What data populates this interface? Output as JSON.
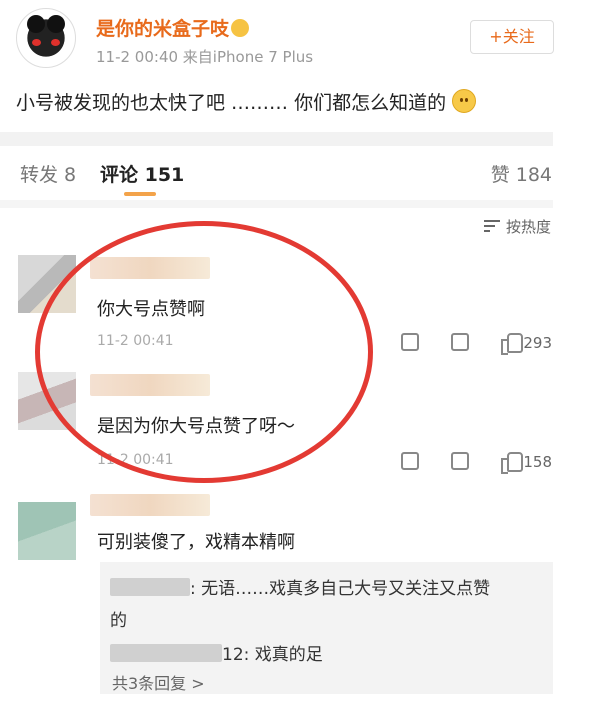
{
  "post": {
    "username": "是你的米盒子吱",
    "meta": "11-2 00:40  来自iPhone 7 Plus",
    "follow_label": "+关注",
    "body": "小号被发现的也太快了吧 ……… 你们都怎么知道的"
  },
  "tabs": {
    "repost": "转发 8",
    "comments": "评论 151",
    "likes": "赞 184"
  },
  "sort_label": "按热度",
  "comments": [
    {
      "text": "你大号点赞啊",
      "time": "11-2 00:41",
      "likes": "293"
    },
    {
      "text": "是因为你大号点赞了呀～",
      "time": "11-2 00:41",
      "likes": "158"
    },
    {
      "text": "可别装傻了，戏精本精啊"
    }
  ],
  "replies": {
    "r1_line1": ": 无语……戏真多自己大号又关注又点赞",
    "r1_line2": "的",
    "r2": "12: 戏真的足",
    "more": "共3条回复 >"
  },
  "colors": {
    "username": "#e86a1b",
    "highlight_circle": "#e33a33",
    "tab_underline": "#f3a34a"
  }
}
